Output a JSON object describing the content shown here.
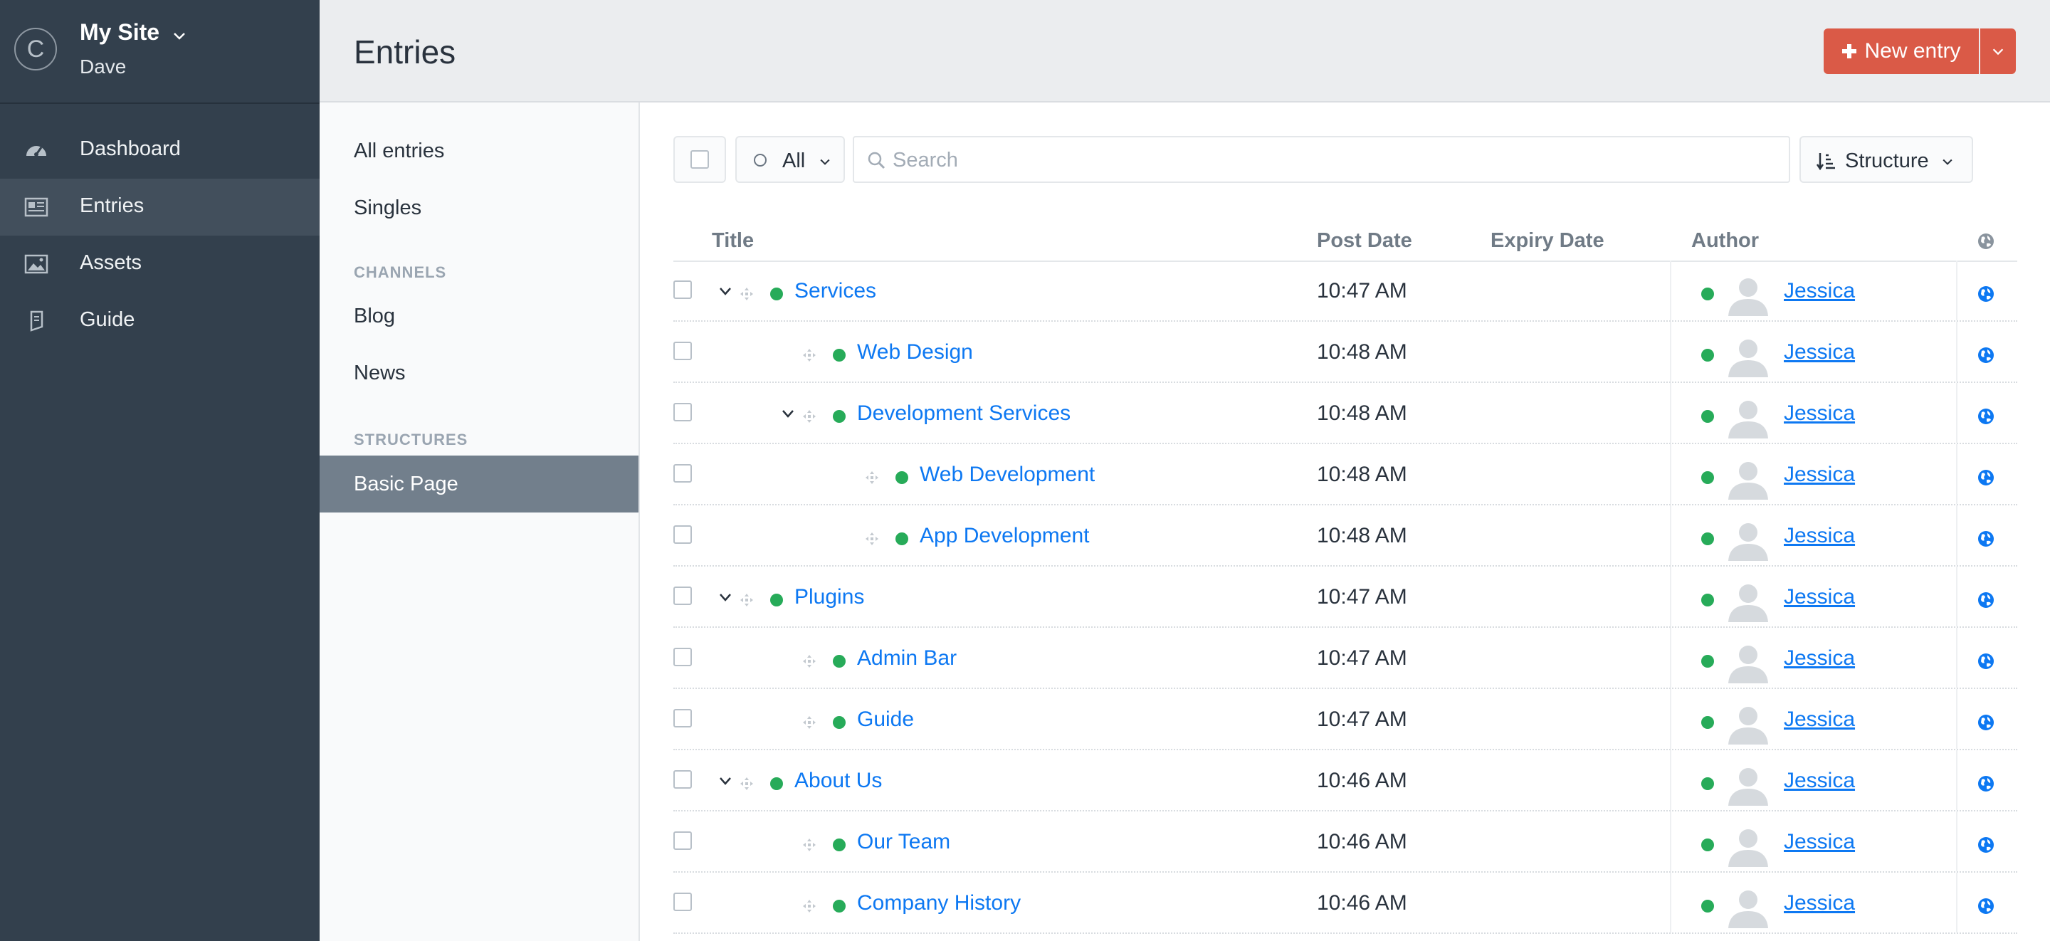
{
  "site": {
    "logo_letter": "C",
    "name": "My Site",
    "user": "Dave"
  },
  "nav": [
    {
      "label": "Dashboard",
      "icon": "gauge-icon"
    },
    {
      "label": "Entries",
      "icon": "newspaper-icon",
      "active": true
    },
    {
      "label": "Assets",
      "icon": "image-icon"
    },
    {
      "label": "Guide",
      "icon": "book-icon"
    }
  ],
  "header": {
    "title": "Entries",
    "new_entry_label": "New entry"
  },
  "sources": {
    "all_entries": "All entries",
    "singles": "Singles",
    "channels_heading": "CHANNELS",
    "channels": [
      "Blog",
      "News"
    ],
    "structures_heading": "STRUCTURES",
    "structures": [
      "Basic Page"
    ],
    "selected": "Basic Page"
  },
  "toolbar": {
    "status_label": "All",
    "search_placeholder": "Search",
    "sort_label": "Structure"
  },
  "table": {
    "columns": [
      "Title",
      "Post Date",
      "Expiry Date",
      "Author"
    ],
    "rows": [
      {
        "title": "Services",
        "level": 1,
        "has_children": true,
        "post_date": "10:47 AM",
        "expiry_date": "",
        "author": "Jessica",
        "status": "live"
      },
      {
        "title": "Web Design",
        "level": 2,
        "has_children": false,
        "post_date": "10:48 AM",
        "expiry_date": "",
        "author": "Jessica",
        "status": "live"
      },
      {
        "title": "Development Services",
        "level": 2,
        "has_children": true,
        "post_date": "10:48 AM",
        "expiry_date": "",
        "author": "Jessica",
        "status": "live"
      },
      {
        "title": "Web Development",
        "level": 3,
        "has_children": false,
        "post_date": "10:48 AM",
        "expiry_date": "",
        "author": "Jessica",
        "status": "live"
      },
      {
        "title": "App Development",
        "level": 3,
        "has_children": false,
        "post_date": "10:48 AM",
        "expiry_date": "",
        "author": "Jessica",
        "status": "live"
      },
      {
        "title": "Plugins",
        "level": 1,
        "has_children": true,
        "post_date": "10:47 AM",
        "expiry_date": "",
        "author": "Jessica",
        "status": "live"
      },
      {
        "title": "Admin Bar",
        "level": 2,
        "has_children": false,
        "post_date": "10:47 AM",
        "expiry_date": "",
        "author": "Jessica",
        "status": "live"
      },
      {
        "title": "Guide",
        "level": 2,
        "has_children": false,
        "post_date": "10:47 AM",
        "expiry_date": "",
        "author": "Jessica",
        "status": "live"
      },
      {
        "title": "About Us",
        "level": 1,
        "has_children": true,
        "post_date": "10:46 AM",
        "expiry_date": "",
        "author": "Jessica",
        "status": "live"
      },
      {
        "title": "Our Team",
        "level": 2,
        "has_children": false,
        "post_date": "10:46 AM",
        "expiry_date": "",
        "author": "Jessica",
        "status": "live"
      },
      {
        "title": "Company History",
        "level": 2,
        "has_children": false,
        "post_date": "10:46 AM",
        "expiry_date": "",
        "author": "Jessica",
        "status": "live"
      }
    ]
  },
  "colors": {
    "sidebar": "#33404d",
    "accent": "#da5a47",
    "link": "#0d78f2",
    "live": "#27ab59"
  }
}
